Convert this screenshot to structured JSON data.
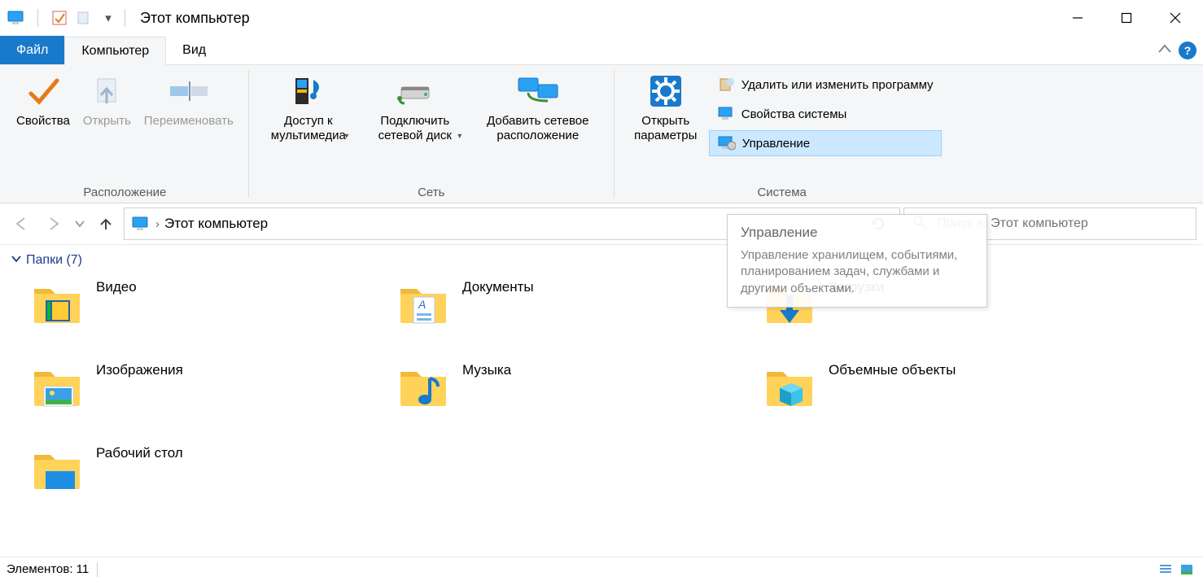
{
  "window": {
    "title": "Этот компьютер"
  },
  "tabs": {
    "file": "Файл",
    "computer": "Компьютер",
    "view": "Вид"
  },
  "ribbon": {
    "location": {
      "caption": "Расположение",
      "properties": "Свойства",
      "open": "Открыть",
      "rename": "Переименовать"
    },
    "network": {
      "caption": "Сеть",
      "media": "Доступ к мультимедиа",
      "map_drive": "Подключить сетевой диск",
      "add_location": "Добавить сетевое расположение"
    },
    "system": {
      "caption": "Система",
      "open_settings": "Открыть параметры",
      "uninstall": "Удалить или изменить программу",
      "sys_props": "Свойства системы",
      "manage": "Управление"
    }
  },
  "address": {
    "crumb": "Этот компьютер"
  },
  "search": {
    "placeholder": "Поиск в: Этот компьютер"
  },
  "tooltip": {
    "title": "Управление",
    "body": "Управление хранилищем, событиями, планированием задач, службами и другими объектами."
  },
  "groups": {
    "folders_header": "Папки (7)"
  },
  "folders": {
    "video": "Видео",
    "documents": "Документы",
    "downloads": "Загрузки",
    "pictures": "Изображения",
    "music": "Музыка",
    "objects3d": "Объемные объекты",
    "desktop": "Рабочий стол"
  },
  "status": {
    "items": "Элементов: 11"
  }
}
